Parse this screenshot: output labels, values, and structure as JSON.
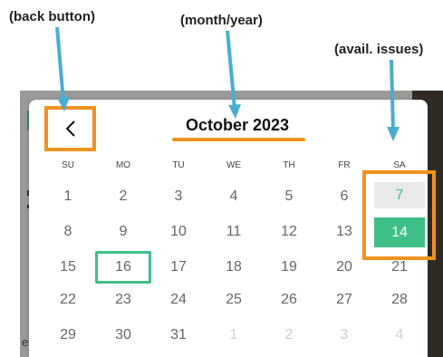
{
  "annotations": {
    "back": "(back button)",
    "month": "(month/year)",
    "issues": "(avail. issues)"
  },
  "calendar": {
    "month_year": "October 2023",
    "back_icon": "chevron-left-icon",
    "weekdays": [
      "SU",
      "MO",
      "TU",
      "WE",
      "TH",
      "FR",
      "SA"
    ],
    "weeks": [
      [
        "1",
        "2",
        "3",
        "4",
        "5",
        "6",
        "7"
      ],
      [
        "8",
        "9",
        "10",
        "11",
        "12",
        "13",
        "14"
      ],
      [
        "15",
        "16",
        "17",
        "18",
        "19",
        "20",
        "21"
      ],
      [
        "22",
        "23",
        "24",
        "25",
        "26",
        "27",
        "28"
      ],
      [
        "29",
        "30",
        "31",
        "1",
        "2",
        "3",
        "4"
      ]
    ],
    "today": "16",
    "available_issues": [
      "7",
      "14"
    ],
    "selected": "14"
  },
  "backdrop": {
    "partial_text": "er"
  },
  "colors": {
    "annotation_orange": "#f0921e",
    "arrow_blue": "#4aaed0",
    "accent_green": "#3fbf88"
  }
}
